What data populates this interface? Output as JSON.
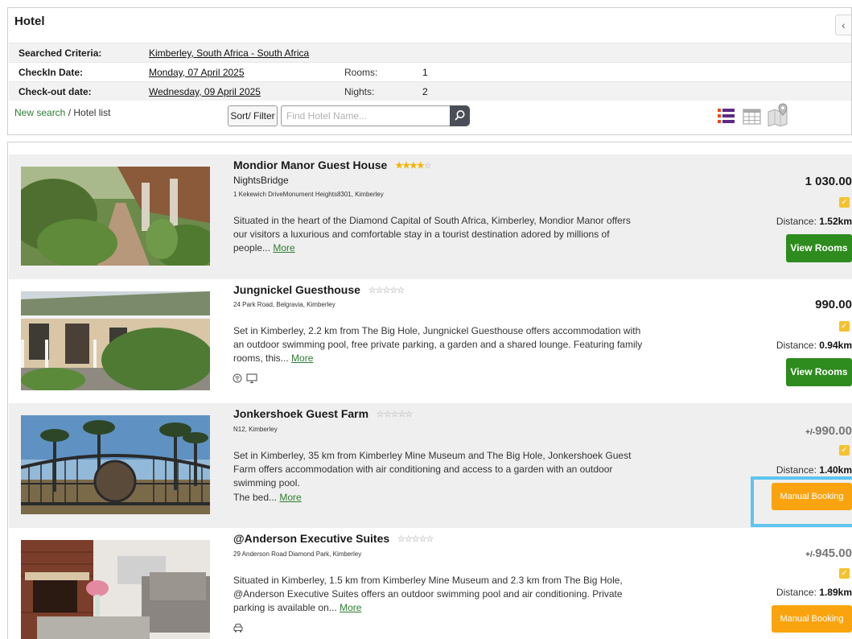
{
  "header": {
    "title": "Hotel",
    "collapse_glyph": "‹"
  },
  "criteria": {
    "searched_label": "Searched Criteria:",
    "searched_value": "Kimberley, South Africa - South Africa",
    "checkin_label": "CheckIn Date:",
    "checkin_value": "Monday, 07 April 2025",
    "rooms_label": "Rooms:",
    "rooms_value": "1",
    "checkout_label": "Check-out date:",
    "checkout_value": "Wednesday, 09 April 2025",
    "nights_label": "Nights:",
    "nights_value": "2"
  },
  "nav": {
    "new_search": "New search",
    "separator": "/",
    "hotel_list": "Hotel list"
  },
  "toolbar": {
    "sort_label": "Sort/ Filter",
    "search_placeholder": "Find Hotel Name...",
    "icons": [
      "list-view-icon",
      "grid-view-icon",
      "map-view-icon"
    ]
  },
  "hotels": [
    {
      "name": "Mondior Manor Guest House",
      "rating": 4,
      "supplier": "NightsBridge",
      "address": "1 Kekewich DriveMonument Heights8301, Kimberley",
      "description": "Situated in the heart of the Diamond Capital of South Africa, Kimberley, Mondior Manor offers our visitors a luxurious and comfortable stay in a tourist destination adored by millions of people...",
      "more": "More",
      "price": "1 030.00",
      "distance_label": "Distance:",
      "distance": "1.52km",
      "button": "View Rooms"
    },
    {
      "name": "Jungnickel Guesthouse",
      "rating": 0,
      "address": "24 Park Road, Belgravia, Kimberley",
      "description": "Set in Kimberley, 2.2 km from The Big Hole, Jungnickel Guesthouse offers accommodation with an outdoor swimming pool, free private parking, a garden and a shared lounge. Featuring family rooms, this...",
      "more": "More",
      "amenities": [
        "wifi-icon",
        "tv-icon"
      ],
      "price": "990.00",
      "distance_label": "Distance:",
      "distance": "0.94km",
      "button": "View Rooms"
    },
    {
      "name": "Jonkershoek Guest Farm",
      "rating": 0,
      "address": "N12, Kimberley",
      "description": "Set in Kimberley, 35 km from Kimberley Mine Museum and The Big Hole, Jonkershoek Guest Farm offers accommodation with air conditioning and access to a garden with an outdoor swimming pool.",
      "description2": "The bed...",
      "more": "More",
      "price_prefix": "+/-",
      "price": "990.00",
      "distance_label": "Distance:",
      "distance": "1.40km",
      "button": "Manual Booking"
    },
    {
      "name": "@Anderson Executive Suites",
      "rating": 0,
      "address": "29 Anderson Road Diamond Park, Kimberley",
      "description": "Situated in Kimberley, 1.5 km from Kimberley Mine Museum and 2.3 km from The Big Hole, @Anderson Executive Suites offers an outdoor swimming pool and air conditioning. Private parking is available on...",
      "more": "More",
      "amenities": [
        "parking-icon"
      ],
      "price_prefix": "+/-",
      "price": "945.00",
      "distance_label": "Distance:",
      "distance": "1.89km",
      "button": "Manual Booking"
    }
  ],
  "colors": {
    "green_button": "#2e8b1e",
    "orange_button": "#f9a40f",
    "highlight_border": "#5ec5ee",
    "star": "#f4b400"
  }
}
